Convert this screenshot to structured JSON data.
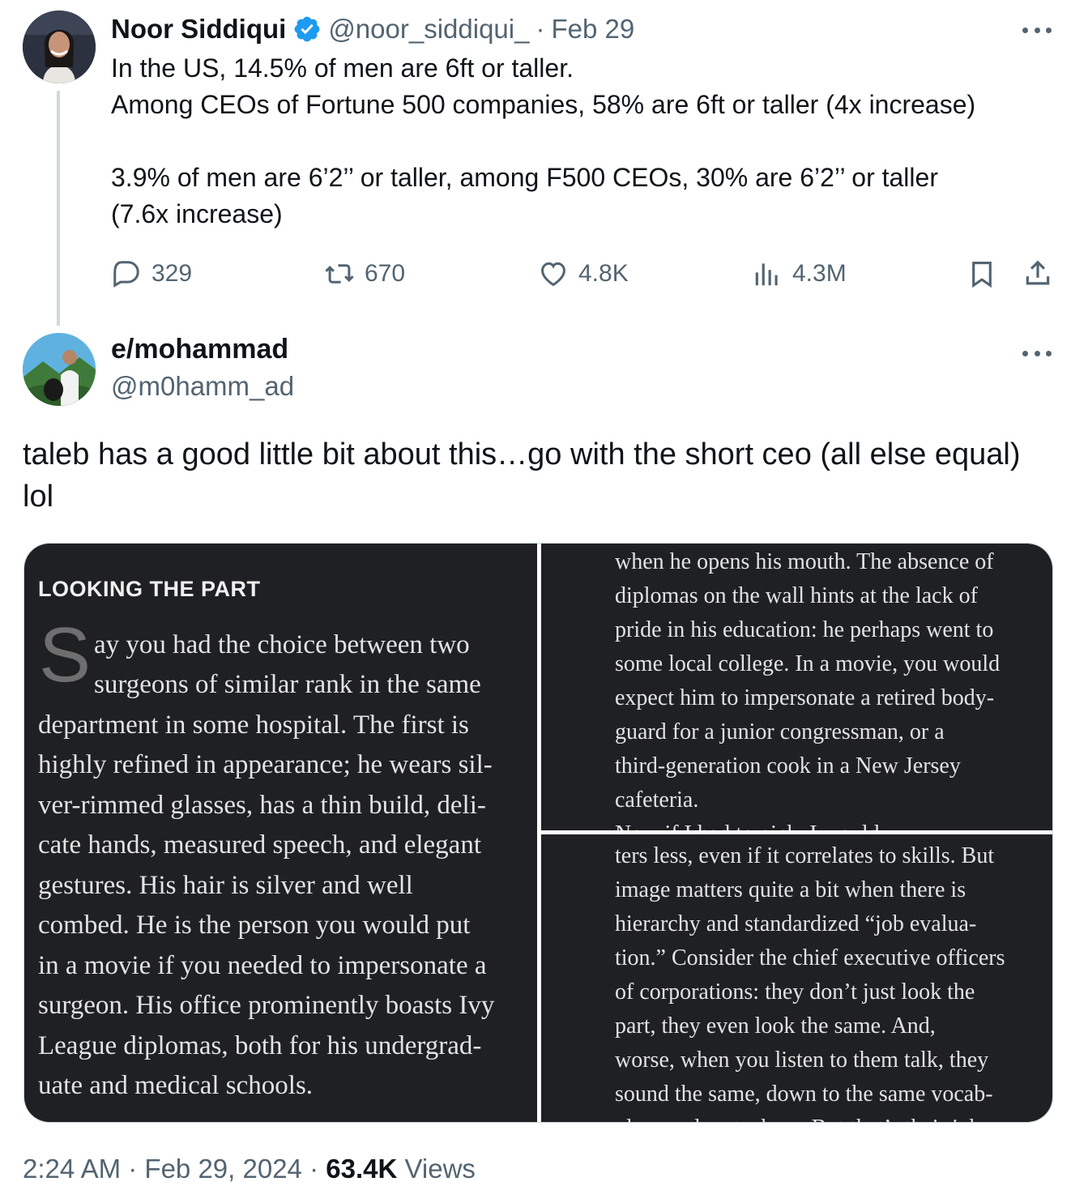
{
  "parent_tweet": {
    "author_name": "Noor Siddiqui",
    "handle": "@noor_siddiqui_",
    "separator": "·",
    "date": "Feb 29",
    "lines": [
      "In the US, 14.5% of men are 6ft or taller.",
      "Among CEOs of Fortune 500 companies, 58% are 6ft or taller (4x increase)",
      "3.9% of men are 6’2’’ or taller, among F500 CEOs, 30% are 6’2’’ or taller",
      "(7.6x increase)"
    ],
    "actions": {
      "replies": "329",
      "reposts": "670",
      "likes": "4.8K",
      "views": "4.3M"
    }
  },
  "reply_tweet": {
    "author_name": "e/mohammad",
    "handle": "@m0hamm_ad",
    "lines": [
      "taleb has a good little bit about this…go with the short ceo (all else equal)",
      "lol"
    ]
  },
  "media": {
    "left": {
      "heading": "LOOKING THE PART",
      "drop_cap": "S",
      "lines": [
        "ay you had the choice between two",
        "surgeons of similar rank in the same",
        "department in some hospital. The first is",
        "highly refined in appearance; he wears sil-",
        "ver-rimmed glasses, has a thin build, deli-",
        "cate hands, measured speech, and elegant",
        "gestures. His hair is silver and well",
        "combed. He is the person you would put",
        "in a movie if you needed to impersonate a",
        "surgeon. His office prominently boasts Ivy",
        "League diplomas, both for his undergrad-",
        "uate and medical schools."
      ]
    },
    "top_right": {
      "lines": [
        "when he opens his mouth. The absence of",
        "diplomas on the wall hints at the lack of",
        "pride in his education: he perhaps went to",
        "some local college. In a movie, you would",
        "expect him to impersonate a retired body-",
        "guard for a junior congressman, or a",
        "third-generation cook in a New Jersey",
        "cafeteria."
      ],
      "cut_line": "Now if I had to pick, I would"
    },
    "bottom_right": {
      "lines": [
        "ters less, even if it correlates to skills. But",
        "image matters quite a bit when there is",
        "hierarchy and standardized “job evalua-",
        "tion.” Consider the chief executive officers",
        "of corporations: they don’t just look the",
        "part, they even look the same. And,",
        "worse, when you listen to them talk, they",
        "sound the same, down to the same vocab-"
      ],
      "cut_line": "ulary and metaphors. But that’s their job"
    }
  },
  "footer": {
    "time": "2:24 AM",
    "sep1": "·",
    "date": "Feb 29, 2024",
    "sep2": "·",
    "views_count": "63.4K",
    "views_label": "Views"
  },
  "colors": {
    "text_primary": "#0f1419",
    "text_secondary": "#536471",
    "verified_blue": "#1d9bf0",
    "thread_line": "#cfd9de",
    "book_page": "#1f2023"
  },
  "icons": [
    "verified-badge-icon",
    "more-icon",
    "reply-icon",
    "repost-icon",
    "like-icon",
    "views-icon",
    "bookmark-icon",
    "share-icon"
  ]
}
